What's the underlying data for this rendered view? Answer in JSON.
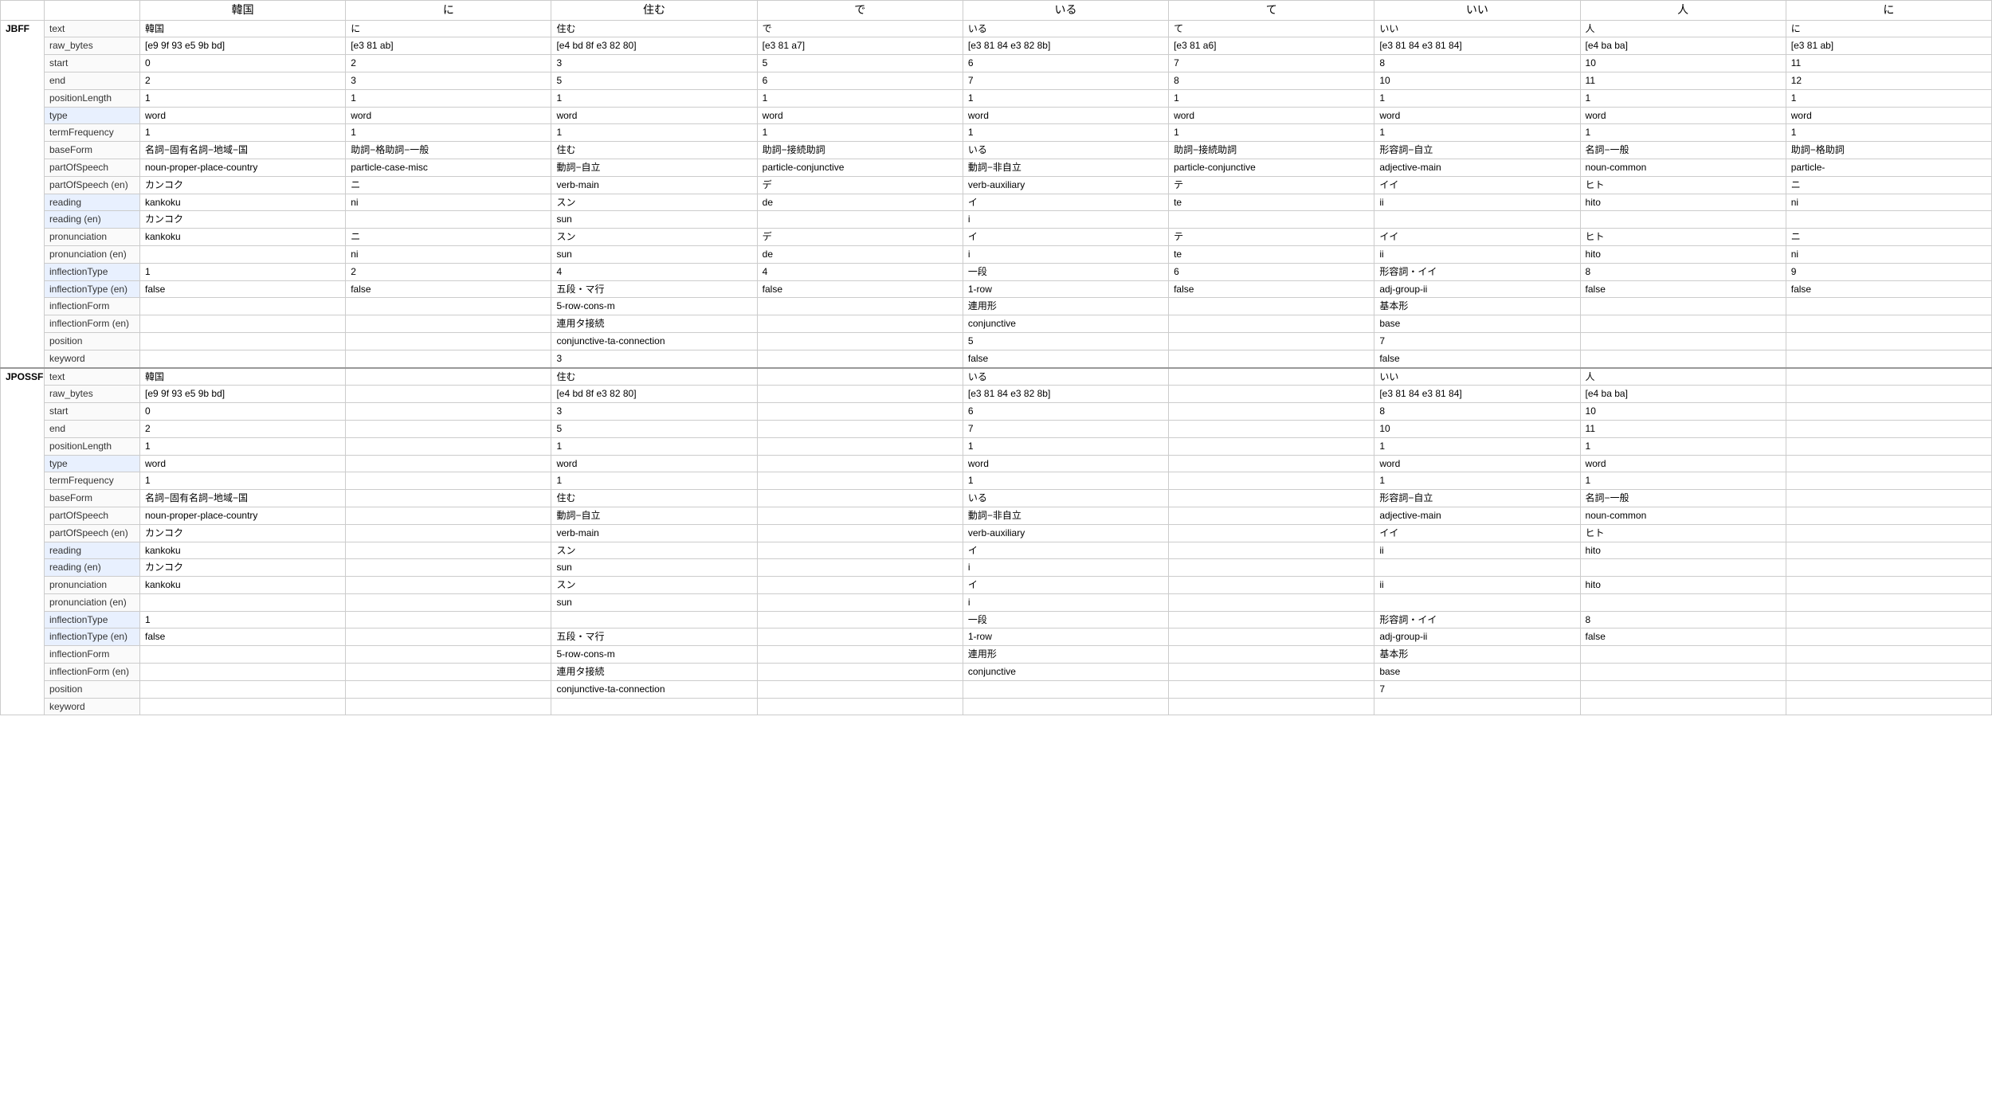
{
  "sections": [
    {
      "id": "JBFF",
      "label": "JBFF",
      "columns": [
        {
          "header": "韓国",
          "props": {
            "text": "韓国",
            "raw_bytes": "[e9 9f 93 e5 9b bd]",
            "start": "0",
            "end": "2",
            "positionLength": "1",
            "type": "word",
            "termFrequency": "1",
            "baseForm": "名詞−固有名詞−地域−国",
            "partOfSpeech": "noun-proper-place-country",
            "partOfSpeech_en": "カンコク",
            "reading": "kankoku",
            "reading_en": "カンコク",
            "pronunciation": "kankoku",
            "pronunciation_en": "",
            "inflectionType": "1",
            "inflectionType_en": "false",
            "inflectionForm": "",
            "inflectionForm_en": "",
            "position": "",
            "keyword": ""
          }
        },
        {
          "header": "に",
          "props": {
            "text": "に",
            "raw_bytes": "[e3 81 ab]",
            "start": "2",
            "end": "3",
            "positionLength": "1",
            "type": "word",
            "termFrequency": "1",
            "baseForm": "助詞−格助詞−一般",
            "partOfSpeech": "particle-case-misc",
            "partOfSpeech_en": "ニ",
            "reading": "ni",
            "reading_en": "",
            "pronunciation": "ニ",
            "pronunciation_en": "ni",
            "inflectionType": "2",
            "inflectionType_en": "false",
            "inflectionForm": "",
            "inflectionForm_en": "",
            "position": "",
            "keyword": ""
          }
        },
        {
          "header": "住む",
          "props": {
            "text": "住む",
            "raw_bytes": "[e4 bd 8f e3 82 80]",
            "start": "3",
            "end": "5",
            "positionLength": "1",
            "type": "word",
            "termFrequency": "1",
            "baseForm": "住む",
            "partOfSpeech": "動詞−自立",
            "partOfSpeech_en": "verb-main",
            "reading": "スン",
            "reading_en": "sun",
            "pronunciation": "スン",
            "pronunciation_en": "sun",
            "inflectionType": "4",
            "inflectionType_en": "五段・マ行",
            "inflectionForm": "5-row-cons-m",
            "inflectionForm_en": "連用タ接続",
            "position": "conjunctive-ta-connection",
            "keyword": "3"
          }
        },
        {
          "header": "で",
          "props": {
            "text": "で",
            "raw_bytes": "[e3 81 a7]",
            "start": "5",
            "end": "6",
            "positionLength": "1",
            "type": "word",
            "termFrequency": "1",
            "baseForm": "助詞−接続助詞",
            "partOfSpeech": "particle-conjunctive",
            "partOfSpeech_en": "デ",
            "reading": "de",
            "reading_en": "",
            "pronunciation": "デ",
            "pronunciation_en": "de",
            "inflectionType": "4",
            "inflectionType_en": "false",
            "inflectionForm": "",
            "inflectionForm_en": "",
            "position": "",
            "keyword": ""
          }
        },
        {
          "header": "いる",
          "props": {
            "text": "いる",
            "raw_bytes": "[e3 81 84 e3 82 8b]",
            "start": "6",
            "end": "7",
            "positionLength": "1",
            "type": "word",
            "termFrequency": "1",
            "baseForm": "いる",
            "partOfSpeech": "動詞−非自立",
            "partOfSpeech_en": "verb-auxiliary",
            "reading": "イ",
            "reading_en": "i",
            "pronunciation": "イ",
            "pronunciation_en": "i",
            "inflectionType": "一段",
            "inflectionType_en": "1-row",
            "inflectionForm": "連用形",
            "inflectionForm_en": "conjunctive",
            "position": "5",
            "keyword": "false"
          }
        },
        {
          "header": "て",
          "props": {
            "text": "て",
            "raw_bytes": "[e3 81 a6]",
            "start": "7",
            "end": "8",
            "positionLength": "1",
            "type": "word",
            "termFrequency": "1",
            "baseForm": "助詞−接続助詞",
            "partOfSpeech": "particle-conjunctive",
            "partOfSpeech_en": "テ",
            "reading": "te",
            "reading_en": "",
            "pronunciation": "テ",
            "pronunciation_en": "te",
            "inflectionType": "6",
            "inflectionType_en": "false",
            "inflectionForm": "",
            "inflectionForm_en": "",
            "position": "",
            "keyword": ""
          }
        },
        {
          "header": "いい",
          "props": {
            "text": "いい",
            "raw_bytes": "[e3 81 84 e3 81 84]",
            "start": "8",
            "end": "10",
            "positionLength": "1",
            "type": "word",
            "termFrequency": "1",
            "baseForm": "形容詞−自立",
            "partOfSpeech": "adjective-main",
            "partOfSpeech_en": "イイ",
            "reading": "ii",
            "reading_en": "",
            "pronunciation": "イイ",
            "pronunciation_en": "ii",
            "inflectionType": "形容詞・イイ",
            "inflectionType_en": "adj-group-ii",
            "inflectionForm": "基本形",
            "inflectionForm_en": "base",
            "position": "7",
            "keyword": "false"
          }
        },
        {
          "header": "人",
          "props": {
            "text": "人",
            "raw_bytes": "[e4 ba ba]",
            "start": "10",
            "end": "11",
            "positionLength": "1",
            "type": "word",
            "termFrequency": "1",
            "baseForm": "名詞−一般",
            "partOfSpeech": "noun-common",
            "partOfSpeech_en": "ヒト",
            "reading": "hito",
            "reading_en": "",
            "pronunciation": "ヒト",
            "pronunciation_en": "hito",
            "inflectionType": "8",
            "inflectionType_en": "false",
            "inflectionForm": "",
            "inflectionForm_en": "",
            "position": "",
            "keyword": ""
          }
        },
        {
          "header": "に",
          "props": {
            "text": "に",
            "raw_bytes": "[e3 81 ab]",
            "start": "11",
            "end": "12",
            "positionLength": "1",
            "type": "word",
            "termFrequency": "1",
            "baseForm": "助詞−格助詞",
            "partOfSpeech": "particle-",
            "partOfSpeech_en": "ニ",
            "reading": "ni",
            "reading_en": "",
            "pronunciation": "ニ",
            "pronunciation_en": "ni",
            "inflectionType": "9",
            "inflectionType_en": "false",
            "inflectionForm": "",
            "inflectionForm_en": "",
            "position": "",
            "keyword": ""
          }
        }
      ]
    },
    {
      "id": "JPOSSF",
      "label": "JPOSSF",
      "columns": [
        {
          "header": "韓国",
          "props": {
            "text": "韓国",
            "raw_bytes": "[e9 9f 93 e5 9b bd]",
            "start": "0",
            "end": "2",
            "positionLength": "1",
            "type": "word",
            "termFrequency": "1",
            "baseForm": "名詞−固有名詞−地域−国",
            "partOfSpeech": "noun-proper-place-country",
            "partOfSpeech_en": "カンコク",
            "reading": "kankoku",
            "reading_en": "カンコク",
            "pronunciation": "kankoku",
            "pronunciation_en": "",
            "inflectionType": "1",
            "inflectionType_en": "false",
            "inflectionForm": "",
            "inflectionForm_en": "",
            "position": "",
            "keyword": ""
          }
        },
        {
          "header": "",
          "props": {
            "text": "",
            "raw_bytes": "",
            "start": "",
            "end": "",
            "positionLength": "",
            "type": "",
            "termFrequency": "",
            "baseForm": "",
            "partOfSpeech": "",
            "partOfSpeech_en": "",
            "reading": "",
            "reading_en": "",
            "pronunciation": "",
            "pronunciation_en": "",
            "inflectionType": "",
            "inflectionType_en": "",
            "inflectionForm": "",
            "inflectionForm_en": "",
            "position": "",
            "keyword": ""
          }
        },
        {
          "header": "住む",
          "props": {
            "text": "住む",
            "raw_bytes": "[e4 bd 8f e3 82 80]",
            "start": "3",
            "end": "5",
            "positionLength": "1",
            "type": "word",
            "termFrequency": "1",
            "baseForm": "住む",
            "partOfSpeech": "動詞−自立",
            "partOfSpeech_en": "verb-main",
            "reading": "スン",
            "reading_en": "sun",
            "pronunciation": "スン",
            "pronunciation_en": "sun",
            "inflectionType": "",
            "inflectionType_en": "五段・マ行",
            "inflectionForm": "5-row-cons-m",
            "inflectionForm_en": "連用タ接続",
            "position": "conjunctive-ta-connection",
            "keyword": ""
          }
        },
        {
          "header": "",
          "props": {
            "text": "",
            "raw_bytes": "",
            "start": "",
            "end": "",
            "positionLength": "",
            "type": "",
            "termFrequency": "",
            "baseForm": "",
            "partOfSpeech": "",
            "partOfSpeech_en": "",
            "reading": "",
            "reading_en": "",
            "pronunciation": "",
            "pronunciation_en": "",
            "inflectionType": "",
            "inflectionType_en": "",
            "inflectionForm": "",
            "inflectionForm_en": "",
            "position": "",
            "keyword": ""
          }
        },
        {
          "header": "いる",
          "props": {
            "text": "いる",
            "raw_bytes": "[e3 81 84 e3 82 8b]",
            "start": "6",
            "end": "7",
            "positionLength": "1",
            "type": "word",
            "termFrequency": "1",
            "baseForm": "いる",
            "partOfSpeech": "動詞−非自立",
            "partOfSpeech_en": "verb-auxiliary",
            "reading": "イ",
            "reading_en": "i",
            "pronunciation": "イ",
            "pronunciation_en": "i",
            "inflectionType": "一段",
            "inflectionType_en": "1-row",
            "inflectionForm": "連用形",
            "inflectionForm_en": "conjunctive",
            "position": "",
            "keyword": ""
          }
        },
        {
          "header": "",
          "props": {
            "text": "",
            "raw_bytes": "",
            "start": "",
            "end": "",
            "positionLength": "",
            "type": "",
            "termFrequency": "",
            "baseForm": "",
            "partOfSpeech": "",
            "partOfSpeech_en": "",
            "reading": "",
            "reading_en": "",
            "pronunciation": "",
            "pronunciation_en": "",
            "inflectionType": "",
            "inflectionType_en": "",
            "inflectionForm": "",
            "inflectionForm_en": "",
            "position": "",
            "keyword": ""
          }
        },
        {
          "header": "いい",
          "props": {
            "text": "いい",
            "raw_bytes": "[e3 81 84 e3 81 84]",
            "start": "8",
            "end": "10",
            "positionLength": "1",
            "type": "word",
            "termFrequency": "1",
            "baseForm": "形容詞−自立",
            "partOfSpeech": "adjective-main",
            "partOfSpeech_en": "イイ",
            "reading": "ii",
            "reading_en": "",
            "pronunciation": "ii",
            "pronunciation_en": "",
            "inflectionType": "形容詞・イイ",
            "inflectionType_en": "adj-group-ii",
            "inflectionForm": "基本形",
            "inflectionForm_en": "base",
            "position": "7",
            "keyword": ""
          }
        },
        {
          "header": "人",
          "props": {
            "text": "人",
            "raw_bytes": "[e4 ba ba]",
            "start": "10",
            "end": "11",
            "positionLength": "1",
            "type": "word",
            "termFrequency": "1",
            "baseForm": "名詞−一般",
            "partOfSpeech": "noun-common",
            "partOfSpeech_en": "ヒト",
            "reading": "hito",
            "reading_en": "",
            "pronunciation": "hito",
            "pronunciation_en": "",
            "inflectionType": "8",
            "inflectionType_en": "false",
            "inflectionForm": "",
            "inflectionForm_en": "",
            "position": "",
            "keyword": ""
          }
        },
        {
          "header": "",
          "props": {
            "text": "",
            "raw_bytes": "",
            "start": "",
            "end": "",
            "positionLength": "",
            "type": "",
            "termFrequency": "",
            "baseForm": "",
            "partOfSpeech": "",
            "partOfSpeech_en": "",
            "reading": "",
            "reading_en": "",
            "pronunciation": "",
            "pronunciation_en": "",
            "inflectionType": "",
            "inflectionType_en": "",
            "inflectionForm": "",
            "inflectionForm_en": "",
            "position": "",
            "keyword": ""
          }
        }
      ]
    }
  ],
  "propLabels": {
    "text": "text",
    "raw_bytes": "raw_bytes",
    "start": "start",
    "end": "end",
    "positionLength": "positionLength",
    "type": "type",
    "termFrequency": "termFrequency",
    "baseForm": "baseForm",
    "partOfSpeech": "partOfSpeech",
    "partOfSpeech_en": "partOfSpeech (en)",
    "reading": "reading",
    "reading_en": "reading (en)",
    "pronunciation": "pronunciation",
    "pronunciation_en": "pronunciation (en)",
    "inflectionType": "inflectionType",
    "inflectionType_en": "inflectionType (en)",
    "inflectionForm": "inflectionForm",
    "inflectionForm_en": "inflectionForm (en)",
    "position": "position",
    "keyword": "keyword"
  }
}
